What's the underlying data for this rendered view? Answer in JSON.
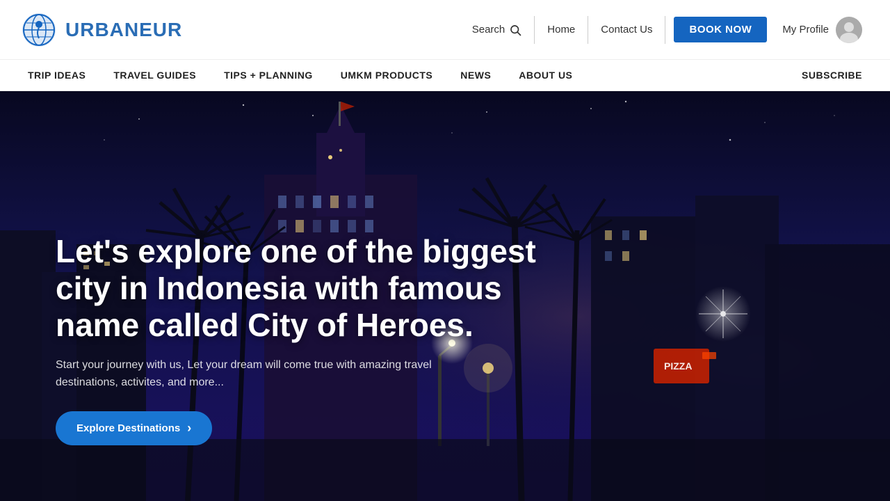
{
  "logo": {
    "text": "URBANEUR",
    "alt": "Urbaneur logo"
  },
  "header": {
    "search_label": "Search",
    "home_label": "Home",
    "contact_label": "Contact Us",
    "book_label": "BOOK NOW",
    "profile_label": "My Profile"
  },
  "nav": {
    "items": [
      {
        "id": "trip-ideas",
        "label": "TRIP IDEAS"
      },
      {
        "id": "travel-guides",
        "label": "TRAVEL GUIDES"
      },
      {
        "id": "tips-planning",
        "label": "TIPS + PLANNING"
      },
      {
        "id": "umkm-products",
        "label": "UMKM PRODUCTS"
      },
      {
        "id": "news",
        "label": "NEWS"
      },
      {
        "id": "about-us",
        "label": "ABOUT US"
      }
    ],
    "subscribe_label": "SUBSCRIBE"
  },
  "hero": {
    "title": "Let's explore one of the biggest city in Indonesia with famous name called City of Heroes.",
    "subtitle": "Start your journey with us, Let your dream will come true with amazing travel destinations, activites, and more...",
    "cta_label": "Explore Destinations",
    "accent_color": "#1976d2"
  }
}
